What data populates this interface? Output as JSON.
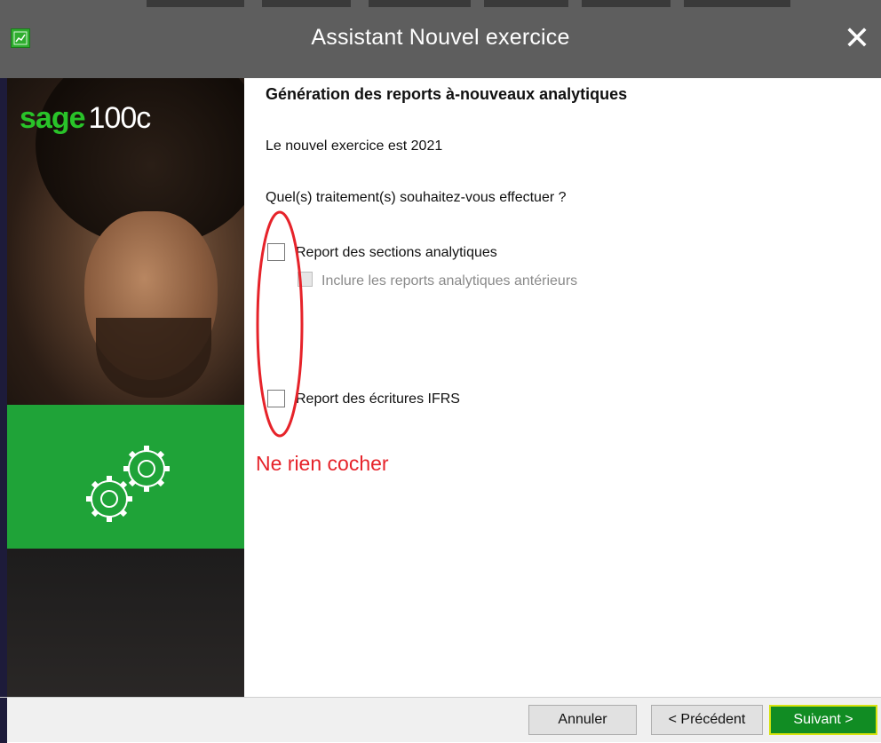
{
  "window": {
    "title": "Assistant Nouvel exercice",
    "close_label": "✕",
    "app_icon": "chart-icon"
  },
  "branding": {
    "logo_sage": "sage",
    "logo_product": "100c",
    "brand_color": "#29c329",
    "accent_green": "#1fa338",
    "gears_icon": "gears-icon"
  },
  "content": {
    "heading": "Génération des reports à-nouveaux analytiques",
    "new_year_text": "Le nouvel exercice est 2021",
    "question": "Quel(s) traitement(s) souhaitez-vous effectuer ?",
    "options": [
      {
        "label": "Report des sections analytiques",
        "checked": false,
        "enabled": true
      },
      {
        "label": "Inclure les reports analytiques antérieurs",
        "checked": false,
        "enabled": false
      },
      {
        "label": "Report des écritures IFRS",
        "checked": false,
        "enabled": true
      }
    ]
  },
  "annotation": {
    "text": "Ne rien cocher",
    "color": "#e6232a"
  },
  "footer": {
    "cancel_label": "Annuler",
    "previous_label": "< Précédent",
    "next_label": "Suivant >",
    "next_color": "#118c23",
    "next_highlight": "#d7e30f"
  }
}
